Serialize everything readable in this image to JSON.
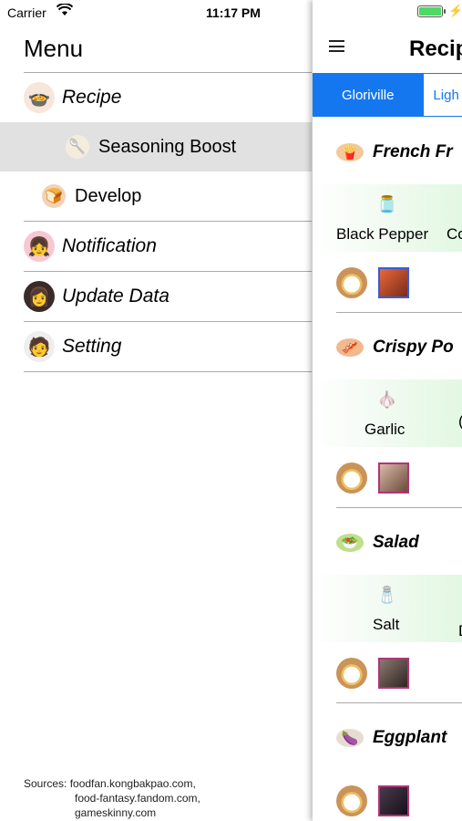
{
  "status": {
    "carrier": "Carrier",
    "time": "11:17 PM"
  },
  "menu": {
    "title": "Menu",
    "items": [
      {
        "label": "Recipe",
        "icon": "recipe-dish-icon"
      },
      {
        "label": "Seasoning Boost",
        "icon": "seasoning-icon",
        "selected": true
      },
      {
        "label": "Develop",
        "icon": "develop-bread-icon"
      },
      {
        "label": "Notification",
        "icon": "notification-avatar-icon"
      },
      {
        "label": "Update Data",
        "icon": "update-avatar-icon"
      },
      {
        "label": "Setting",
        "icon": "setting-avatar-icon"
      }
    ]
  },
  "sources": {
    "line1": "Sources: foodfan.kongbakpao.com,",
    "line2": "food-fantasy.fandom.com,",
    "line3": "gameskinny.com"
  },
  "panel": {
    "title": "Recip",
    "tabs": [
      "Gloriville",
      "Ligh"
    ],
    "recipes": [
      {
        "name": "French Fr",
        "ingredient": "Black Pepper",
        "ingredient2": "Co",
        "portrait_color": "#3a5bd8"
      },
      {
        "name": "Crispy Po",
        "ingredient": "Garlic",
        "ingredient2": "(",
        "portrait_color": "#b0337a"
      },
      {
        "name": "Salad",
        "ingredient": "Salt",
        "ingredient2": "D",
        "portrait_color": "#b0337a"
      },
      {
        "name": "Eggplant",
        "portrait_color": "#b0337a"
      }
    ]
  },
  "colors": {
    "accent": "#1577f0",
    "selected_row": "#e1e1e1",
    "ingredient_band": "#d8f6d8"
  }
}
